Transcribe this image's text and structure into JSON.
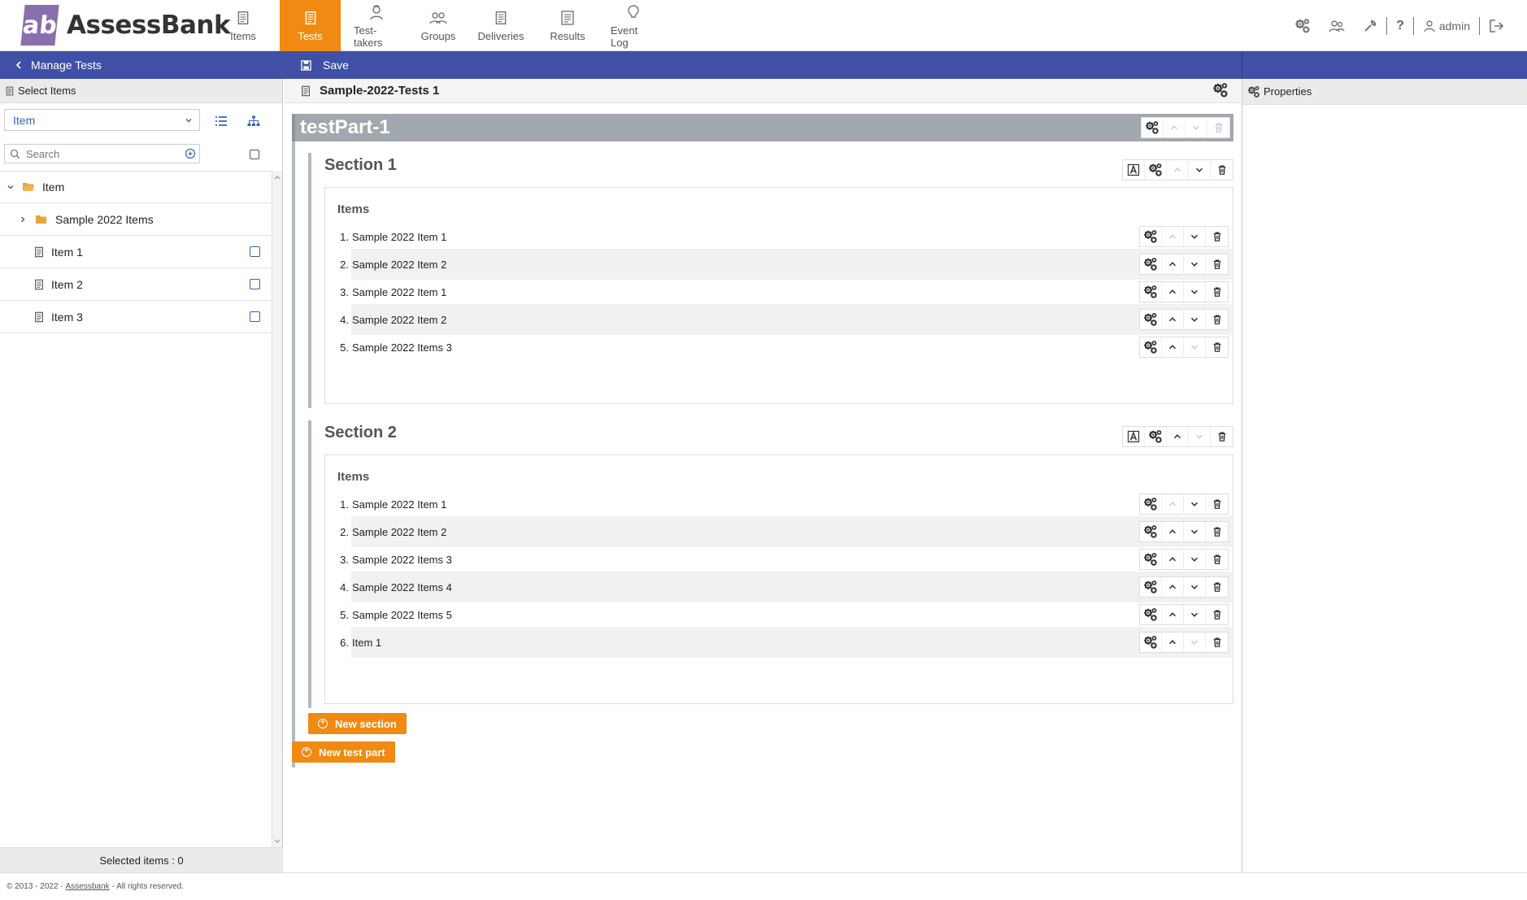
{
  "brand": {
    "badge": "ab",
    "name": "AssessBank"
  },
  "nav": [
    {
      "label": "Items",
      "icon": "items-icon"
    },
    {
      "label": "Tests",
      "icon": "tests-icon",
      "active": true
    },
    {
      "label": "Test-takers",
      "icon": "test-takers-icon"
    },
    {
      "label": "Groups",
      "icon": "groups-icon"
    },
    {
      "label": "Deliveries",
      "icon": "deliveries-icon"
    },
    {
      "label": "Results",
      "icon": "results-icon"
    },
    {
      "label": "Event Log",
      "icon": "event-log-icon"
    }
  ],
  "user": {
    "name": "admin",
    "help": "?"
  },
  "actionbar": {
    "manage": "Manage Tests",
    "save": "Save"
  },
  "left": {
    "title": "Select Items",
    "select_value": "Item",
    "search_placeholder": "Search",
    "tree": {
      "root": "Item",
      "folder": "Sample 2022 Items",
      "items": [
        "Item 1",
        "Item 2",
        "Item 3"
      ]
    },
    "footer": "Selected items : 0"
  },
  "test": {
    "title": "Sample-2022-Tests 1",
    "part": "testPart-1",
    "sections": [
      {
        "title": "Section 1",
        "items_label": "Items",
        "items": [
          {
            "num": "1.",
            "label": "Sample 2022 Item 1"
          },
          {
            "num": "2.",
            "label": "Sample 2022 Item 2"
          },
          {
            "num": "3.",
            "label": "Sample 2022 Item 1"
          },
          {
            "num": "4.",
            "label": "Sample 2022 Item 2"
          },
          {
            "num": "5.",
            "label": "Sample 2022 Items 3"
          }
        ]
      },
      {
        "title": "Section 2",
        "items_label": "Items",
        "items": [
          {
            "num": "1.",
            "label": "Sample 2022 Item 1"
          },
          {
            "num": "2.",
            "label": "Sample 2022 Item 2"
          },
          {
            "num": "3.",
            "label": "Sample 2022 Items 3"
          },
          {
            "num": "4.",
            "label": "Sample 2022 Items 4"
          },
          {
            "num": "5.",
            "label": "Sample 2022 Items 5"
          },
          {
            "num": "6.",
            "label": "Item 1"
          }
        ]
      }
    ],
    "new_section": "New section",
    "new_test_part": "New test part"
  },
  "right": {
    "title": "Properties"
  },
  "footer": {
    "prefix": "© 2013 - 2022 -",
    "link": "Assessbank",
    "suffix": "- All rights reserved."
  },
  "colors": {
    "accent": "#f08a12",
    "bar": "#4050a6",
    "link": "#3a62b8"
  }
}
